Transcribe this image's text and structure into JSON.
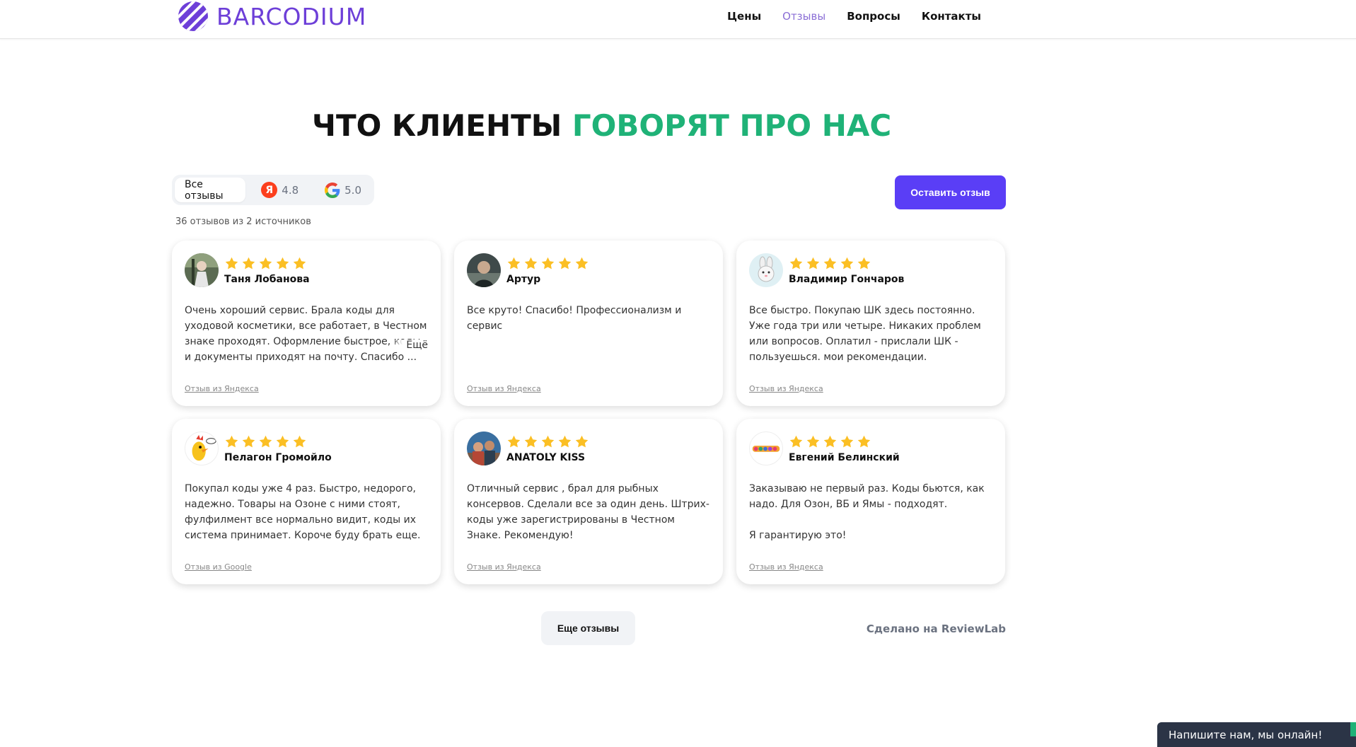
{
  "header": {
    "logo_text": "BARCODIUM",
    "nav": [
      "Цены",
      "Отзывы",
      "Вопросы",
      "Контакты"
    ]
  },
  "title": {
    "part1": "ЧТО КЛИЕНТЫ ",
    "part2": "ГОВОРЯТ ПРО НАС"
  },
  "filters": {
    "all": "Все отзывы",
    "yandex_letter": "Я",
    "yandex_score": "4.8",
    "google_score": "5.0"
  },
  "count_text": "36 отзывов из 2 источников",
  "leave_button": "Оставить отзыв",
  "cards": [
    {
      "author": "Таня Лобанова",
      "rating": 5,
      "text": [
        "Очень хороший сервис. Брала коды для уходовой косметики, все работает, в Честном знаке проходят. Оформление быстрое, коды и документы приходят на почту. Спасибо ..."
      ],
      "more": "Ещё",
      "source": "Отзыв из Яндекса",
      "avatar": "photo-woman"
    },
    {
      "author": "Артур",
      "rating": 5,
      "text": [
        "Все круто! Спасибо! Профессионализм и сервис"
      ],
      "source": "Отзыв из Яндекса",
      "avatar": "photo-man"
    },
    {
      "author": "Владимир Гончаров",
      "rating": 5,
      "text": [
        "Все быстро. Покупаю ШК здесь постоянно. Уже года три или четыре. Никаких проблем или вопросов. Оплатил - прислали ШК - пользуешься. мои рекомендации."
      ],
      "source": "Отзыв из Яндекса",
      "avatar": "rabbit"
    },
    {
      "author": "Пелагон Громойло",
      "rating": 5,
      "text": [
        "Покупал коды уже 4 раз. Быстро, недорого, надежно. Товары на Озоне с ними стоят, фулфилмент все нормально видит, коды их система принимает. Короче буду брать еще."
      ],
      "source": "Отзыв из Google",
      "avatar": "chicken"
    },
    {
      "author": "ANATOLY KISS",
      "rating": 5,
      "text": [
        "Отличный сервис , брал для рыбных консервов. Сделали все за один день. Штрих-коды уже зарегистрированы в Честном Знаке. Рекомендую!"
      ],
      "source": "Отзыв из Яндекса",
      "avatar": "photo-group"
    },
    {
      "author": "Евгений Белинский",
      "rating": 5,
      "text": [
        "Заказываю не первый раз. Коды бьются, как надо. Для Озон, ВБ и Ямы - подходят.",
        "Я гарантирую это!"
      ],
      "source": "Отзыв из Яндекса",
      "avatar": "colorful-logo"
    }
  ],
  "more_reviews_button": "Еще отзывы",
  "made_with": "Сделано на ReviewLab",
  "chat_text": "Напишите нам, мы онлайн!",
  "colors": {
    "brand": "#6d3fd8",
    "accent_green": "#1fb277",
    "button": "#5a3ef6",
    "star": "#fbbf24"
  }
}
